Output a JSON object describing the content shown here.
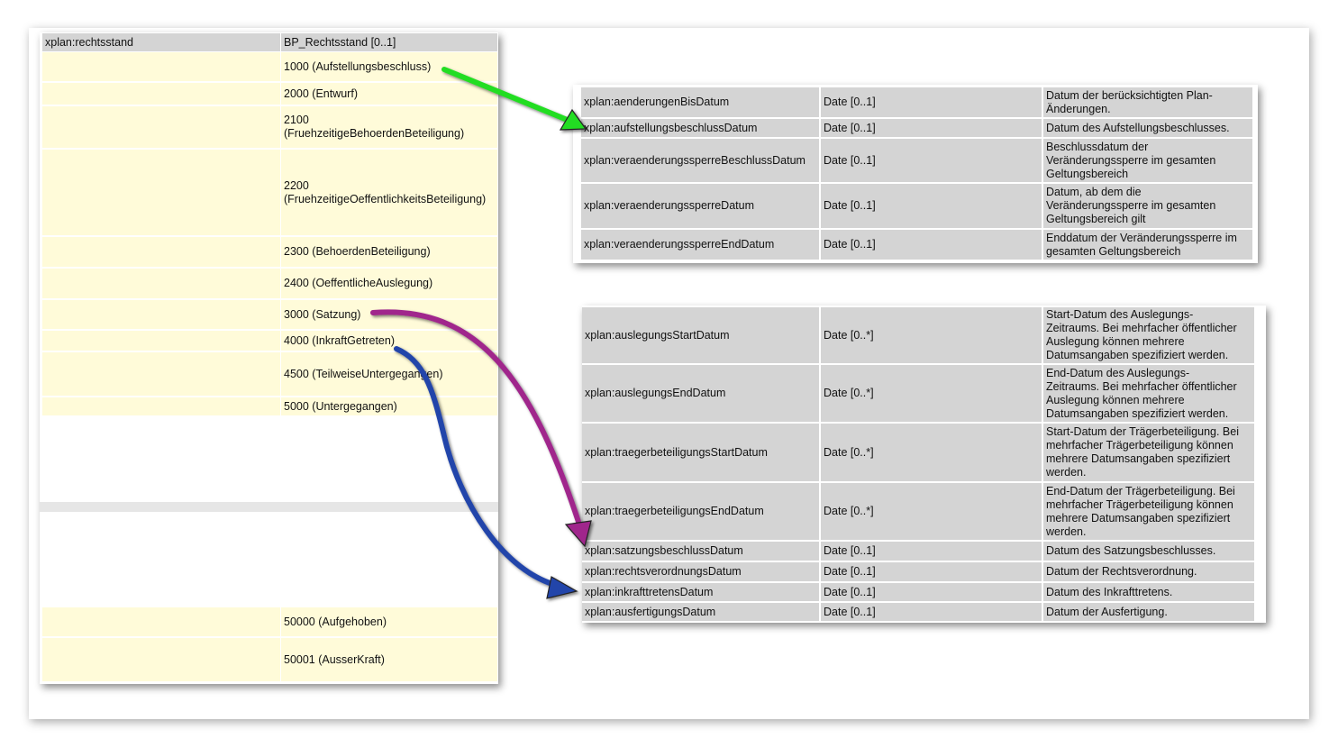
{
  "left_table": {
    "header": {
      "field": "xplan:rechtsstand",
      "type": "BP_Rechtsstand [0..1]"
    },
    "values": [
      "1000 (Aufstellungsbeschluss)",
      "2000 (Entwurf)",
      "2100\n(FruehzeitigeBehoerdenBeteiligung)",
      "2200\n(FruehzeitigeOeffentlichkeitsBeteiligung)",
      "2300 (BehoerdenBeteiligung)",
      "2400 (OeffentlicheAuslegung)",
      "3000 (Satzung)",
      "4000 (InkraftGetreten)",
      "4500 (TeilweiseUntergegangen)",
      "5000 (Untergegangen)",
      "50000 (Aufgehoben)",
      "50001 (AusserKraft)"
    ]
  },
  "table_top": {
    "rows": [
      {
        "field": "xplan:aenderungenBisDatum",
        "type": "Date [0..1]",
        "desc": "Datum der berücksichtigten Plan-\nÄnderungen."
      },
      {
        "field": "xplan:aufstellungsbeschlussDatum",
        "type": "Date [0..1]",
        "desc": "Datum des Aufstellungsbeschlusses."
      },
      {
        "field": "xplan:veraenderungssperreBeschlussDatum",
        "type": "Date [0..1]",
        "desc": "Beschlussdatum der\nVeränderungssperre im gesamten\nGeltungsbereich"
      },
      {
        "field": "xplan:veraenderungssperreDatum",
        "type": "Date [0..1]",
        "desc": "Datum, ab dem die\nVeränderungssperre im gesamten\nGeltungsbereich gilt"
      },
      {
        "field": "xplan:veraenderungssperreEndDatum",
        "type": "Date [0..1]",
        "desc": "Enddatum der Veränderungssperre im\ngesamten Geltungsbereich"
      }
    ]
  },
  "table_bottom": {
    "rows": [
      {
        "field": "xplan:auslegungsStartDatum",
        "type": "Date [0..*]",
        "desc": "Start-Datum des Auslegungs-\nZeitraums. Bei mehrfacher öffentlicher\nAuslegung können mehrere\nDatumsangaben spezifiziert werden."
      },
      {
        "field": "xplan:auslegungsEndDatum",
        "type": "Date [0..*]",
        "desc": "End-Datum des Auslegungs-\nZeitraums. Bei mehrfacher öffentlicher\nAuslegung können mehrere\nDatumsangaben spezifiziert werden."
      },
      {
        "field": "xplan:traegerbeteiligungsStartDatum",
        "type": "Date [0..*]",
        "desc": "Start-Datum der Trägerbeteiligung. Bei\nmehrfacher Trägerbeteiligung können\nmehrere Datumsangaben spezifiziert\nwerden."
      },
      {
        "field": "xplan:traegerbeteiligungsEndDatum",
        "type": "Date [0..*]",
        "desc": "End-Datum der Trägerbeteiligung. Bei\nmehrfacher Trägerbeteiligung können\nmehrere Datumsangaben spezifiziert\nwerden."
      },
      {
        "field": "xplan:satzungsbeschlussDatum",
        "type": "Date [0..1]",
        "desc": "Datum des Satzungsbeschlusses."
      },
      {
        "field": "xplan:rechtsverordnungsDatum",
        "type": "Date [0..1]",
        "desc": "Datum der Rechtsverordnung."
      },
      {
        "field": "xplan:inkrafttretensDatum",
        "type": "Date [0..1]",
        "desc": "Datum des Inkrafttretens."
      },
      {
        "field": "xplan:ausfertigungsDatum",
        "type": "Date [0..1]",
        "desc": "Datum der Ausfertigung."
      }
    ]
  },
  "arrow_colors": {
    "green": "#22dd22",
    "purple": "#a0288c",
    "blue": "#2244aa"
  }
}
